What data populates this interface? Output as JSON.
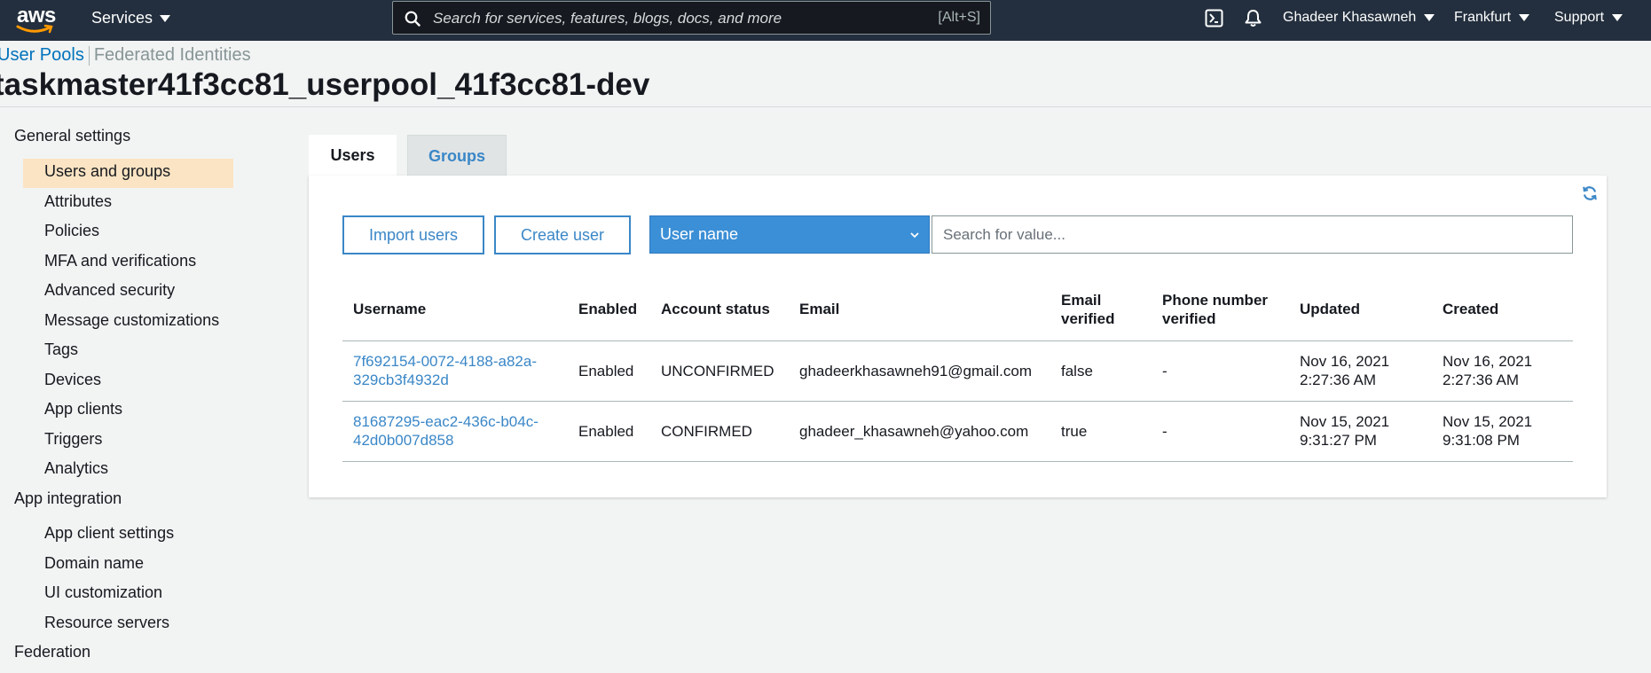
{
  "topnav": {
    "logo_text": "aws",
    "services_label": "Services",
    "search_placeholder": "Search for services, features, blogs, docs, and more",
    "search_shortcut": "[Alt+S]",
    "user_label": "Ghadeer Khasawneh",
    "region_label": "Frankfurt",
    "support_label": "Support",
    "icons": [
      "cloudshell-icon",
      "bell-icon",
      "search-icon"
    ]
  },
  "breadcrumb": {
    "user_pools": "User Pools",
    "federated_identities": "Federated Identities"
  },
  "page_title": "taskmaster41f3cc81_userpool_41f3cc81-dev",
  "sidebar": {
    "sections": [
      {
        "label": "General settings",
        "items": [
          "Users and groups",
          "Attributes",
          "Policies",
          "MFA and verifications",
          "Advanced security",
          "Message customizations",
          "Tags",
          "Devices",
          "App clients",
          "Triggers",
          "Analytics"
        ]
      },
      {
        "label": "App integration",
        "items": [
          "App client settings",
          "Domain name",
          "UI customization",
          "Resource servers"
        ]
      },
      {
        "label": "Federation",
        "items": []
      }
    ],
    "active_item": "Users and groups"
  },
  "tabs": {
    "users": "Users",
    "groups": "Groups",
    "active": "Users"
  },
  "toolbar": {
    "import_label": "Import users",
    "create_label": "Create user",
    "filter_selected": "User name",
    "search_placeholder": "Search for value..."
  },
  "table": {
    "headers": {
      "username": "Username",
      "enabled": "Enabled",
      "account_status": "Account status",
      "email": "Email",
      "email_verified_1": "Email",
      "email_verified_2": "verified",
      "phone_verified_1": "Phone number",
      "phone_verified_2": "verified",
      "updated": "Updated",
      "created": "Created"
    },
    "rows": [
      {
        "username_1": "7f692154-0072-4188-a82a-",
        "username_2": "329cb3f4932d",
        "enabled": "Enabled",
        "status": "UNCONFIRMED",
        "email": "ghadeerkhasawneh91@gmail.com",
        "email_verified": "false",
        "phone_verified": "-",
        "updated_1": "Nov 16, 2021",
        "updated_2": "2:27:36 AM",
        "created_1": "Nov 16, 2021",
        "created_2": "2:27:36 AM"
      },
      {
        "username_1": "81687295-eac2-436c-b04c-",
        "username_2": "42d0b007d858",
        "enabled": "Enabled",
        "status": "CONFIRMED",
        "email": "ghadeer_khasawneh@yahoo.com",
        "email_verified": "true",
        "phone_verified": "-",
        "updated_1": "Nov 15, 2021",
        "updated_2": "9:31:27 PM",
        "created_1": "Nov 15, 2021",
        "created_2": "9:31:08 PM"
      }
    ]
  },
  "colors": {
    "nav_bg": "#232f3e",
    "link": "#0073bb",
    "accent_blue": "#3a87c7",
    "select_bg": "#3b8fd6",
    "active_item_bg": "#fbe4c3"
  }
}
